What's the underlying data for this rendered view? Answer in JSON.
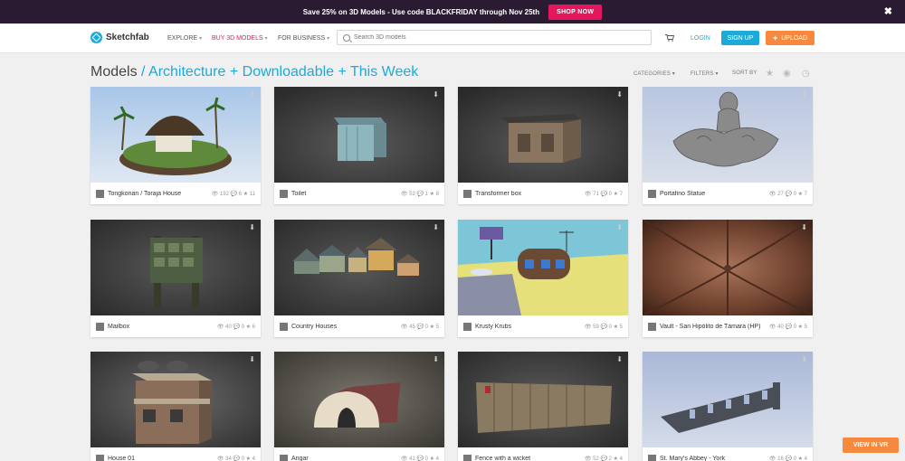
{
  "promo": {
    "text": "Save 25% on 3D Models - Use code BLACKFRIDAY through Nov 25th",
    "button": "SHOP NOW",
    "close_glyph": "✖"
  },
  "nav": {
    "logo": "Sketchfab",
    "explore": "EXPLORE",
    "buy": "BUY 3D MODELS",
    "business": "FOR BUSINESS",
    "search_placeholder": "Search 3D models",
    "login": "LOGIN",
    "signup": "SIGN UP",
    "upload": "UPLOAD",
    "accent_color": "#1caad9",
    "upload_color": "#f6893d",
    "buy_color": "#e4175e"
  },
  "header": {
    "title": "Models",
    "subtitle": " / Architecture + Downloadable + This Week",
    "categories": "CATEGORIES",
    "filters": "FILTERS",
    "sort_by": "SORT BY"
  },
  "models": [
    {
      "name": "Tongkonan / Toraja House",
      "stats": "👁 192 💬 6 ★ 11",
      "scene": "tongkonan"
    },
    {
      "name": "Toilet",
      "stats": "👁 52 💬 1 ★ 8",
      "scene": "toilet"
    },
    {
      "name": "Transformer box",
      "stats": "👁 71 💬 0 ★ 7",
      "scene": "transformer"
    },
    {
      "name": "Portafino Statue",
      "stats": "👁 27 💬 0 ★ 7",
      "scene": "statue"
    },
    {
      "name": "Mailbox",
      "stats": "👁 40 💬 0 ★ 6",
      "scene": "mailbox"
    },
    {
      "name": "Country Houses",
      "stats": "👁 45 💬 0 ★ 5",
      "scene": "houses"
    },
    {
      "name": "Krusty Krubs",
      "stats": "👁 59 💬 0 ★ 5",
      "scene": "krusty"
    },
    {
      "name": "Vault - San Hipólito de Támara (HP)",
      "stats": "👁 40 💬 0 ★ 5",
      "scene": "vault"
    },
    {
      "name": "House 01",
      "stats": "👁 34 💬 0 ★ 4",
      "scene": "house01"
    },
    {
      "name": "Angar",
      "stats": "👁 41 💬 0 ★ 4",
      "scene": "angar"
    },
    {
      "name": "Fence with a wicket",
      "stats": "👁 52 💬 2 ★ 4",
      "scene": "fence"
    },
    {
      "name": "St. Mary's Abbey - York",
      "stats": "👁 16 💬 0 ★ 4",
      "scene": "abbey"
    }
  ],
  "vr_button": "VIEW IN VR"
}
